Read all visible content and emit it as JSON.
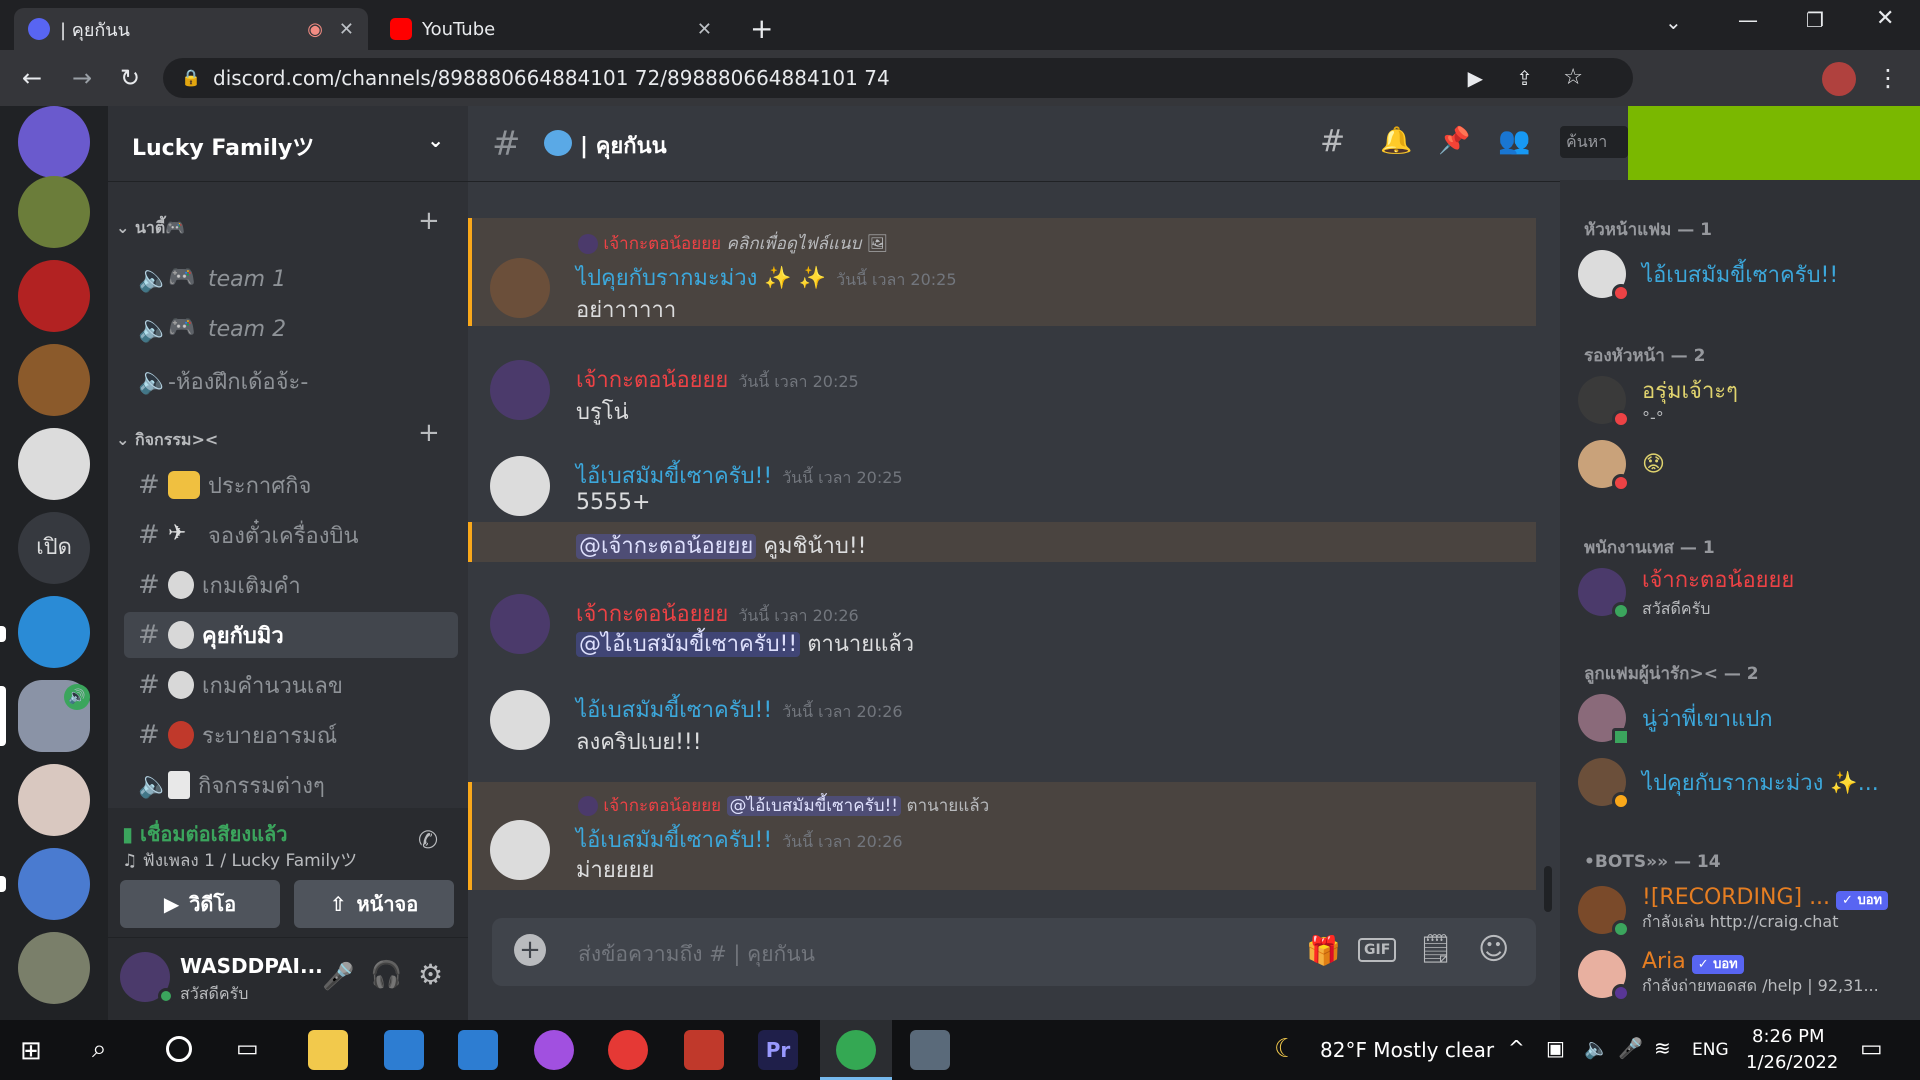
{
  "browser": {
    "tabs": [
      {
        "title": "| คุยกันน",
        "active": true
      },
      {
        "title": "YouTube",
        "active": false
      }
    ],
    "url": "discord.com/channels/898880664884101 72/898880664884101 74"
  },
  "server": {
    "name": "Lucky Familyツ",
    "guild_text_icon": "เปิด",
    "categories": [
      {
        "name": "นาตี้🎮",
        "channels": [
          {
            "type": "voice",
            "name": "team 1"
          },
          {
            "type": "voice",
            "name": "team 2"
          },
          {
            "type": "voice",
            "name": "-ห้องฝึกเด้อจ้ะ-"
          }
        ]
      },
      {
        "name": "กิจกรรม><",
        "channels": [
          {
            "type": "text",
            "name": "ประกาศกิจ"
          },
          {
            "type": "text",
            "name": "จองตั๋วเครื่องบิน"
          },
          {
            "type": "text",
            "name": "เกมเติมคำ"
          },
          {
            "type": "text",
            "name": "คุยกับมิว",
            "selected": true
          },
          {
            "type": "text",
            "name": "เกมคำนวนเลข"
          },
          {
            "type": "text",
            "name": "ระบายอารมณ์"
          },
          {
            "type": "voice",
            "name": "กิจกรรมต่างๆ"
          }
        ]
      }
    ]
  },
  "voice_panel": {
    "status": "เชื่อมต่อเสียงแล้ว",
    "detail": "ฟังเพลง 1 / Lucky Familyツ",
    "video_label": "วิดีโอ",
    "screen_label": "หน้าจอ"
  },
  "user_panel": {
    "name": "WASDDPAI...",
    "status": "สวัสดีครับ"
  },
  "chat": {
    "channel_name": "| คุยกันน",
    "search_placeholder": "ค้นหา",
    "composer_placeholder": "ส่งข้อความถึง # | คุยกันน",
    "messages": [
      {
        "reply_author": "เจ้ากะตอน้อยยย",
        "reply_text": "คลิกเพื่อดูไฟล์แนบ",
        "author": "ไปคุยกับรากมะม่วง ✨ ✨",
        "time": "วันนี้ เวลา 20:25",
        "text": "อย่าาาาาา",
        "mention": true
      },
      {
        "author": "เจ้ากะตอน้อยยย",
        "time": "วันนี้ เวลา 20:25",
        "text": "บรูโน่"
      },
      {
        "author": "ไอ้เบสมัมขี้เซาครับ!!",
        "time": "วันนี้ เวลา 20:25",
        "text": "5555+",
        "followup_mention": "@เจ้ากะตอน้อยยย",
        "followup_text": "คูมชิน้าบ!!"
      },
      {
        "author": "เจ้ากะตอน้อยยย",
        "time": "วันนี้ เวลา 20:26",
        "mention": "@ไอ้เบสมัมขี้เซาครับ!!",
        "text": "ตานายแล้ว"
      },
      {
        "author": "ไอ้เบสมัมขี้เซาครับ!!",
        "time": "วันนี้ เวลา 20:26",
        "text": "ลงคริปเบย!!!"
      },
      {
        "reply_author": "เจ้ากะตอน้อยยย",
        "reply_mention": "@ไอ้เบสมัมขี้เซาครับ!!",
        "reply_text": "ตานายแล้ว",
        "author": "ไอ้เบสมัมขี้เซาครับ!!",
        "time": "วันนี้ เวลา 20:26",
        "text": "ม่ายยยย"
      }
    ]
  },
  "members": {
    "groups": [
      {
        "title": "หัวหน้าแฟม — 1",
        "members": [
          {
            "name": "ไอ้เบสมัมขี้เซาครับ!!",
            "color": "#3ca8dc",
            "status": "dnd"
          }
        ]
      },
      {
        "title": "รองหัวหน้า — 2",
        "members": [
          {
            "name": "อรุ่มเจ้าะๆ",
            "sub": "°-°",
            "color": "#e0d36e",
            "status": "dnd"
          },
          {
            "name": "😟",
            "color": "#e0d36e",
            "status": "dnd"
          }
        ]
      },
      {
        "title": "พนักงานเทส — 1",
        "members": [
          {
            "name": "เจ้ากะตอน้อยยย",
            "sub": "สวัสดีครับ",
            "color": "#ed4245",
            "status": "online"
          }
        ]
      },
      {
        "title": "ลูกแฟมผู้น่ารัก>< — 2",
        "members": [
          {
            "name": "นู่ว่าพี่เขาแปก",
            "color": "#3ca8dc",
            "status": "mobile"
          },
          {
            "name": "ไปคุยกับรากมะม่วง ✨...",
            "color": "#3ca8dc",
            "status": "idle"
          }
        ]
      },
      {
        "title": "•BOTS»» — 14",
        "members": [
          {
            "name": "![RECORDING] ...",
            "sub": "กำลังเล่น http://craig.chat",
            "color": "#e67e22",
            "bot": "✓ บอท",
            "status": "online"
          },
          {
            "name": "Aria",
            "sub": "กำลังถ่ายทอดสด /help | 92,31...",
            "color": "#e67e22",
            "bot": "✓ บอท",
            "status": "streaming"
          }
        ]
      }
    ]
  },
  "taskbar": {
    "weather": "82°F  Mostly clear",
    "lang": "ENG",
    "time": "8:26 PM",
    "date": "1/26/2022"
  }
}
